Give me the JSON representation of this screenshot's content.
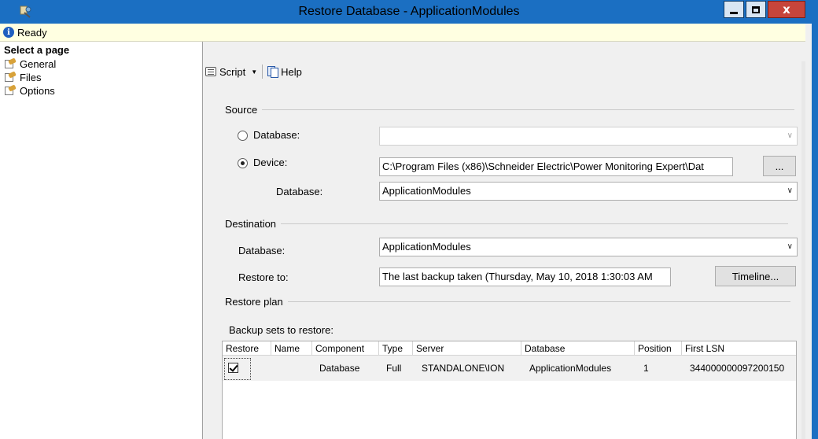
{
  "window": {
    "title": "Restore Database - ApplicationModules",
    "close_glyph": "x"
  },
  "status": {
    "text": "Ready",
    "icon": "info-icon"
  },
  "sidebar": {
    "header": "Select a page",
    "items": [
      {
        "label": "General",
        "icon": "page-settings-icon",
        "selected": true
      },
      {
        "label": "Files",
        "icon": "page-settings-icon"
      },
      {
        "label": "Options",
        "icon": "page-settings-icon"
      }
    ]
  },
  "toolbar": {
    "script_label": "Script",
    "help_label": "Help"
  },
  "source": {
    "header": "Source",
    "database_radio_label": "Database:",
    "database_value": "",
    "device_radio_label": "Device:",
    "device_path": "C:\\Program Files (x86)\\Schneider Electric\\Power Monitoring Expert\\Dat",
    "browse_label": "...",
    "sub_database_label": "Database:",
    "sub_database_value": "ApplicationModules",
    "selected": "device"
  },
  "destination": {
    "header": "Destination",
    "database_label": "Database:",
    "database_value": "ApplicationModules",
    "restore_to_label": "Restore to:",
    "restore_to_value": "The last backup taken (Thursday, May 10, 2018 1:30:03 AM",
    "timeline_label": "Timeline..."
  },
  "restore_plan": {
    "header": "Restore plan",
    "backup_sets_label": "Backup sets to restore:",
    "columns": [
      "Restore",
      "Name",
      "Component",
      "Type",
      "Server",
      "Database",
      "Position",
      "First LSN"
    ],
    "rows": [
      {
        "restore": true,
        "name": "",
        "component": "Database",
        "type": "Full",
        "server": "STANDALONE\\ION",
        "database": "ApplicationModules",
        "position": "1",
        "first_lsn": "344000000097200150"
      }
    ]
  }
}
